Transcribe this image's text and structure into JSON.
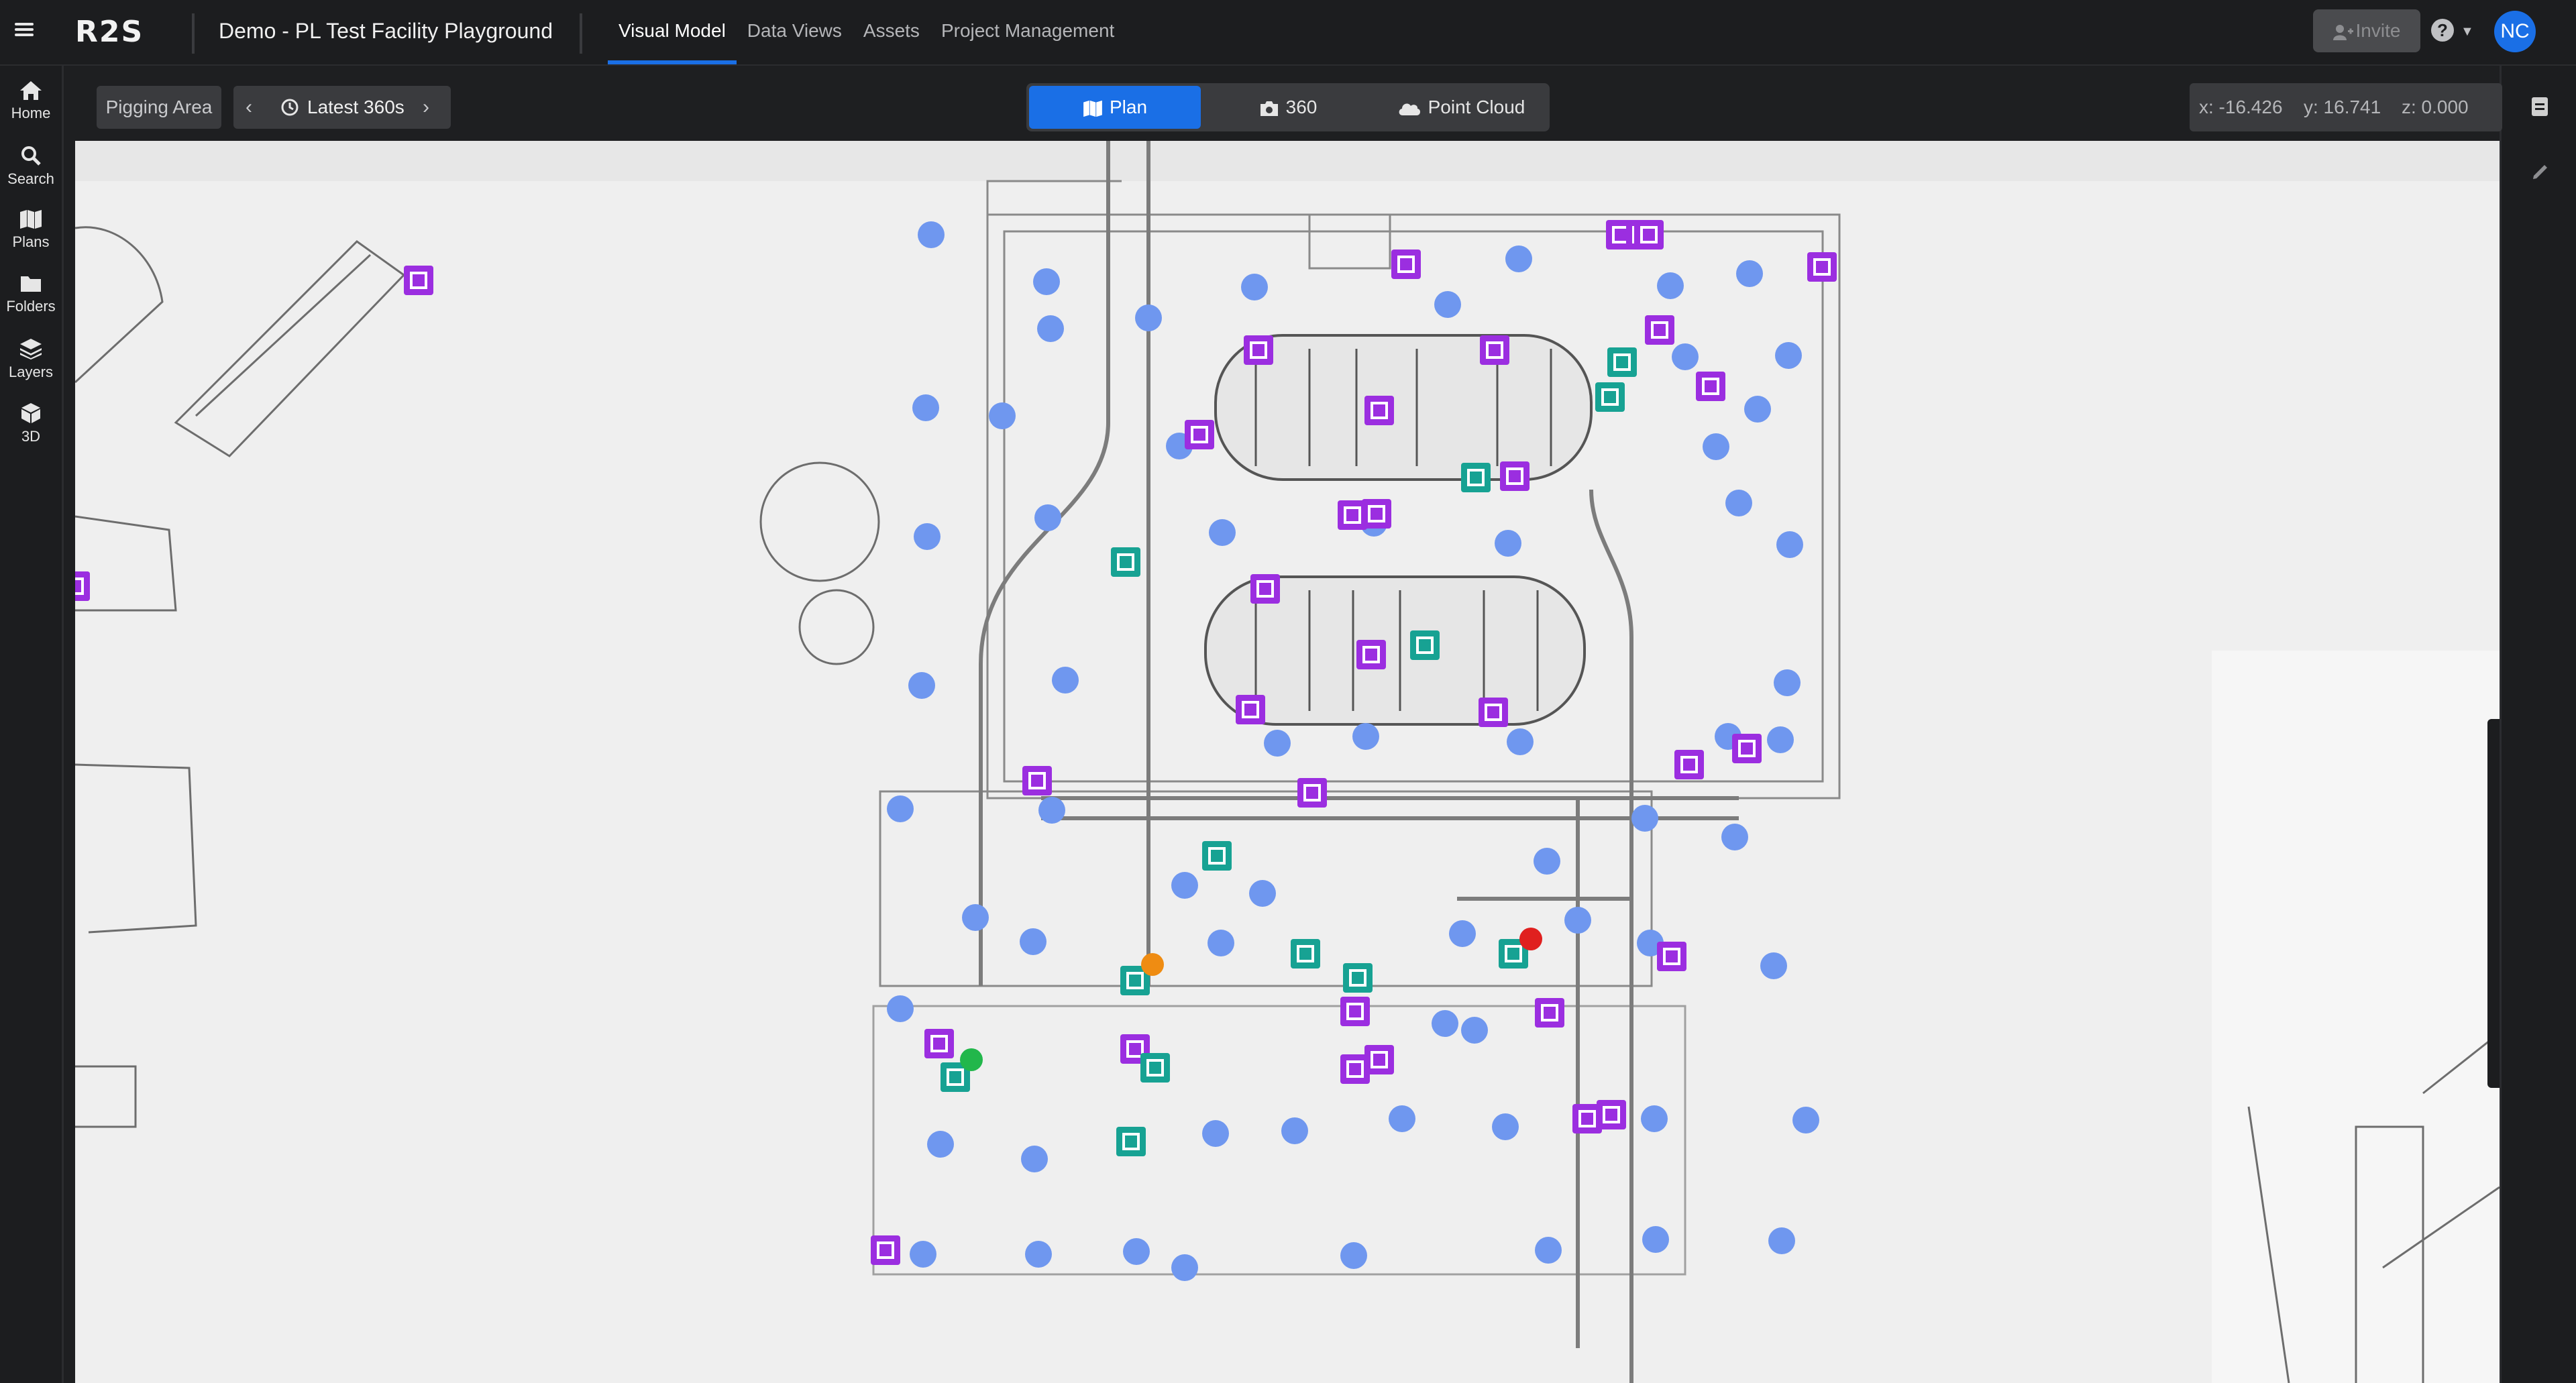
{
  "header": {
    "logo": "R2S",
    "project_title": "Demo - PL Test Facility Playground",
    "tabs": [
      {
        "label": "Visual Model",
        "active": true
      },
      {
        "label": "Data Views",
        "active": false
      },
      {
        "label": "Assets",
        "active": false
      },
      {
        "label": "Project Management",
        "active": false
      }
    ],
    "invite_label": "Invite",
    "help_label": "?",
    "avatar_initials": "NC"
  },
  "sidebar": {
    "items": [
      {
        "label": "Home",
        "icon": "home-icon"
      },
      {
        "label": "Search",
        "icon": "search-icon"
      },
      {
        "label": "Plans",
        "icon": "map-icon"
      },
      {
        "label": "Folders",
        "icon": "folder-icon"
      },
      {
        "label": "Layers",
        "icon": "layers-icon"
      },
      {
        "label": "3D",
        "icon": "cube-icon"
      }
    ]
  },
  "toolbar": {
    "area_label": "Pigging Area",
    "capture_label": "Latest 360s",
    "view_modes": [
      {
        "label": "Plan",
        "icon": "map-icon",
        "active": true
      },
      {
        "label": "360",
        "icon": "camera-icon",
        "active": false
      },
      {
        "label": "Point Cloud",
        "icon": "cloud-icon",
        "active": false
      }
    ],
    "coords": {
      "x": "x: -16.426",
      "y": "y: 16.741",
      "z": "z: 0.000"
    }
  },
  "map_tools": [
    "add-icon",
    "ruler-icon",
    "polygon-icon",
    "select-area-icon",
    "zoom-in-icon",
    "zoom-out-icon",
    "pencil-icon"
  ],
  "colors": {
    "accent": "#1a6fe6",
    "capture_point": "#6f97ef",
    "marker_purple": "#9b2ee0",
    "marker_teal": "#17a293",
    "status_red": "#e0201f",
    "status_orange": "#ef8c12",
    "status_green": "#22b74b"
  }
}
